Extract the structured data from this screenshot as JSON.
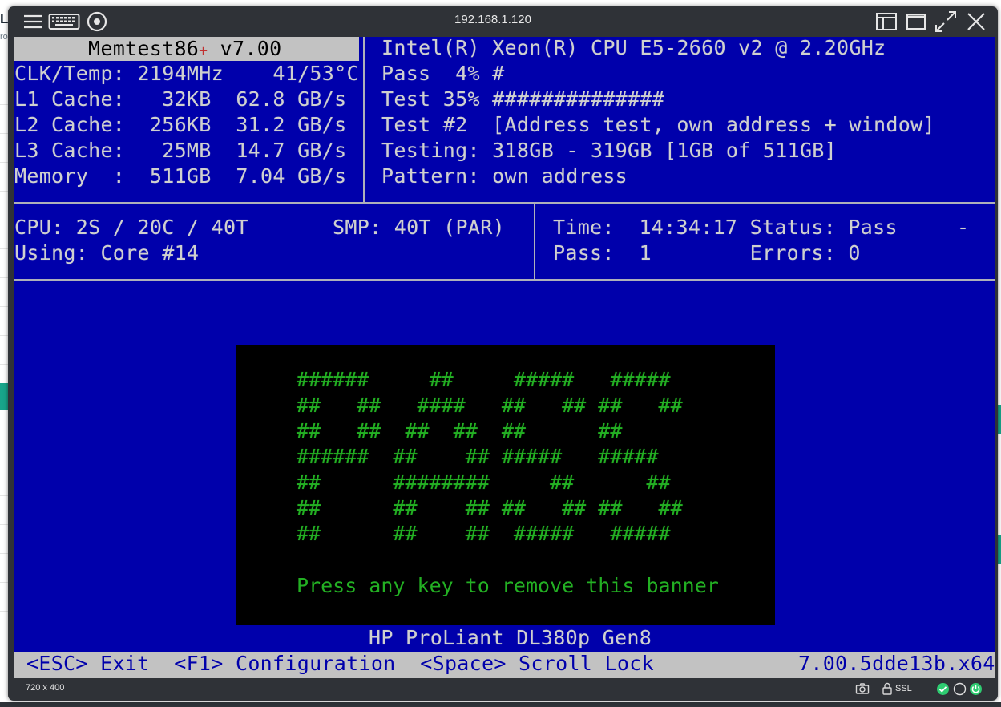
{
  "window": {
    "title": "192.168.1.120",
    "resolution": "720 x 400",
    "ssl_label": "SSL"
  },
  "background": {
    "left_logo": "L",
    "left_sub": "roL"
  },
  "memtest": {
    "title_name": "Memtest86",
    "title_plus": "+",
    "title_version": "v7.00",
    "left_rows": [
      "CLK/Temp: 2194MHz    41/53°C",
      "L1 Cache:   32KB  62.8 GB/s",
      "L2 Cache:  256KB  31.2 GB/s",
      "L3 Cache:   25MB  14.7 GB/s",
      "Memory  :  511GB  7.04 GB/s"
    ],
    "right_rows": [
      "Intel(R) Xeon(R) CPU E5-2660 v2 @ 2.20GHz",
      "Pass  4% #",
      "Test 35% ##############",
      "Test #2  [Address test, own address + window]",
      "Testing: 318GB - 319GB [1GB of 511GB]",
      "Pattern: own address"
    ],
    "cpu_info": "CPU: 2S / 20C / 40T",
    "smp_info": "SMP: 40T (PAR)",
    "using_core": "Using: Core #14",
    "time_row": "Time:  14:34:17 Status: Pass",
    "pass_row": "Pass:  1        Errors: 0",
    "spinner": "-",
    "banner_art": "######     ##     #####   #####\n##   ##   ####   ##   ## ##   ##\n##   ##  ##  ##  ##      ##\n######  ##    ## #####   #####\n##      ########     ##      ##\n##      ##    ## ##   ## ##   ##\n##      ##    ##  #####   #####",
    "banner_message": "Press any key to remove this banner",
    "machine_name": "HP ProLiant DL380p Gen8",
    "status_help": "<ESC> Exit  <F1> Configuration  <Space> Scroll Lock",
    "build_version": "7.00.5dde13b.x64"
  },
  "colors": {
    "console_bg": "#0000ab",
    "console_text": "#cfd0cf",
    "highlight_bg": "#c2c2c2",
    "banner_bg": "#000000",
    "banner_text": "#23b023",
    "viewer_chrome": "#2f3237",
    "status_ok": "#2ecc71"
  },
  "icons": {
    "menu": "hamburger-icon",
    "keyboard": "keyboard-icon",
    "record": "target-icon",
    "layout": "layout-icon",
    "maximize": "maximize-icon",
    "fullscreen": "fullscreen-icon",
    "close": "close-icon",
    "screenshot": "camera-icon",
    "lock": "lock-icon",
    "status_ok": "check-circle-icon",
    "status_idle": "circle-icon",
    "power": "power-icon"
  }
}
